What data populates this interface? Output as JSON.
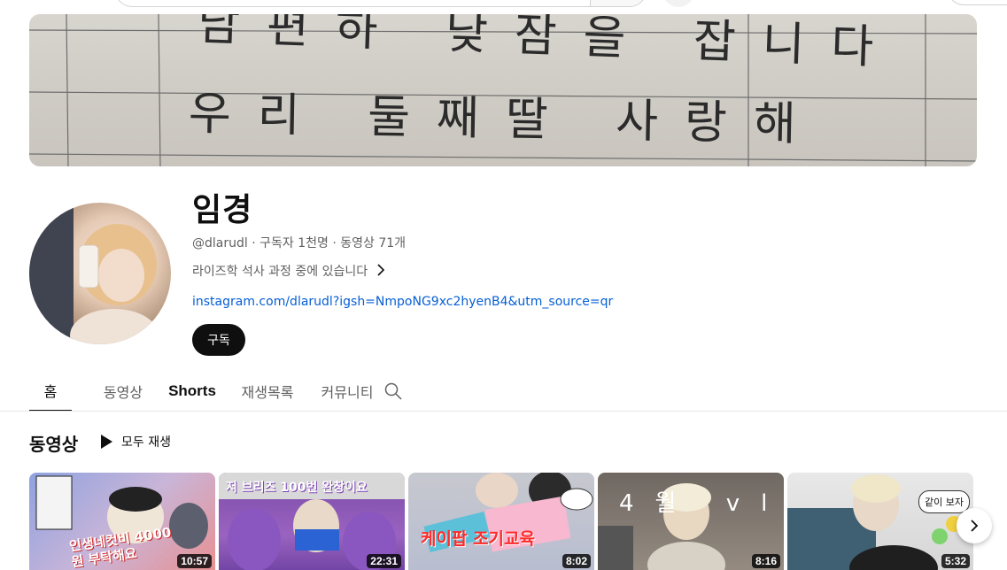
{
  "channel": {
    "name": "임경",
    "handle": "@dlarudl",
    "subscribers": "구독자 1천명",
    "videos": "동영상 71개",
    "separator": "·",
    "description": "라이즈학 석사 과정 중에 있습니다",
    "link": "instagram.com/dlarudl?igsh=NmpoNG9xc2hyenB4&utm_source=qr",
    "subscribe_label": "구독"
  },
  "banner": {
    "line1": "남편하 낮잠을 잡니다",
    "line2": "우리 둘째딸 사랑해"
  },
  "tabs": [
    {
      "label": "홈",
      "active": true
    },
    {
      "label": "동영상",
      "active": false
    },
    {
      "label": "Shorts",
      "active": false
    },
    {
      "label": "재생목록",
      "active": false
    },
    {
      "label": "커뮤니티",
      "active": false
    }
  ],
  "section": {
    "title": "동영상",
    "play_all": "모두 재생"
  },
  "videos": [
    {
      "duration": "10:57",
      "overlay": "인생네컷비 4000원 부탁해요",
      "colors": [
        "#7f8fd6",
        "#e86a6a"
      ]
    },
    {
      "duration": "22:31",
      "overlay": "저 브리즈 100번 완창이요",
      "colors": [
        "#6a3c9a",
        "#c07adf"
      ]
    },
    {
      "duration": "8:02",
      "overlay": "케이팝 조기교육",
      "colors": [
        "#8aa0c8",
        "#f0b8c8"
      ]
    },
    {
      "duration": "8:16",
      "overlay": "4월 vlog",
      "colors": [
        "#8a7d72",
        "#c9bfb4"
      ]
    },
    {
      "duration": "5:32",
      "overlay": "같이 보자",
      "colors": [
        "#4a6a7a",
        "#e8e8e8"
      ]
    }
  ],
  "icons": {
    "search": "search-icon",
    "play": "play-icon",
    "chevron_right": "chevron-right-icon"
  },
  "colors": {
    "link": "#065fd4",
    "subscribe_bg": "#0f0f0f",
    "muted_text": "#606060"
  }
}
